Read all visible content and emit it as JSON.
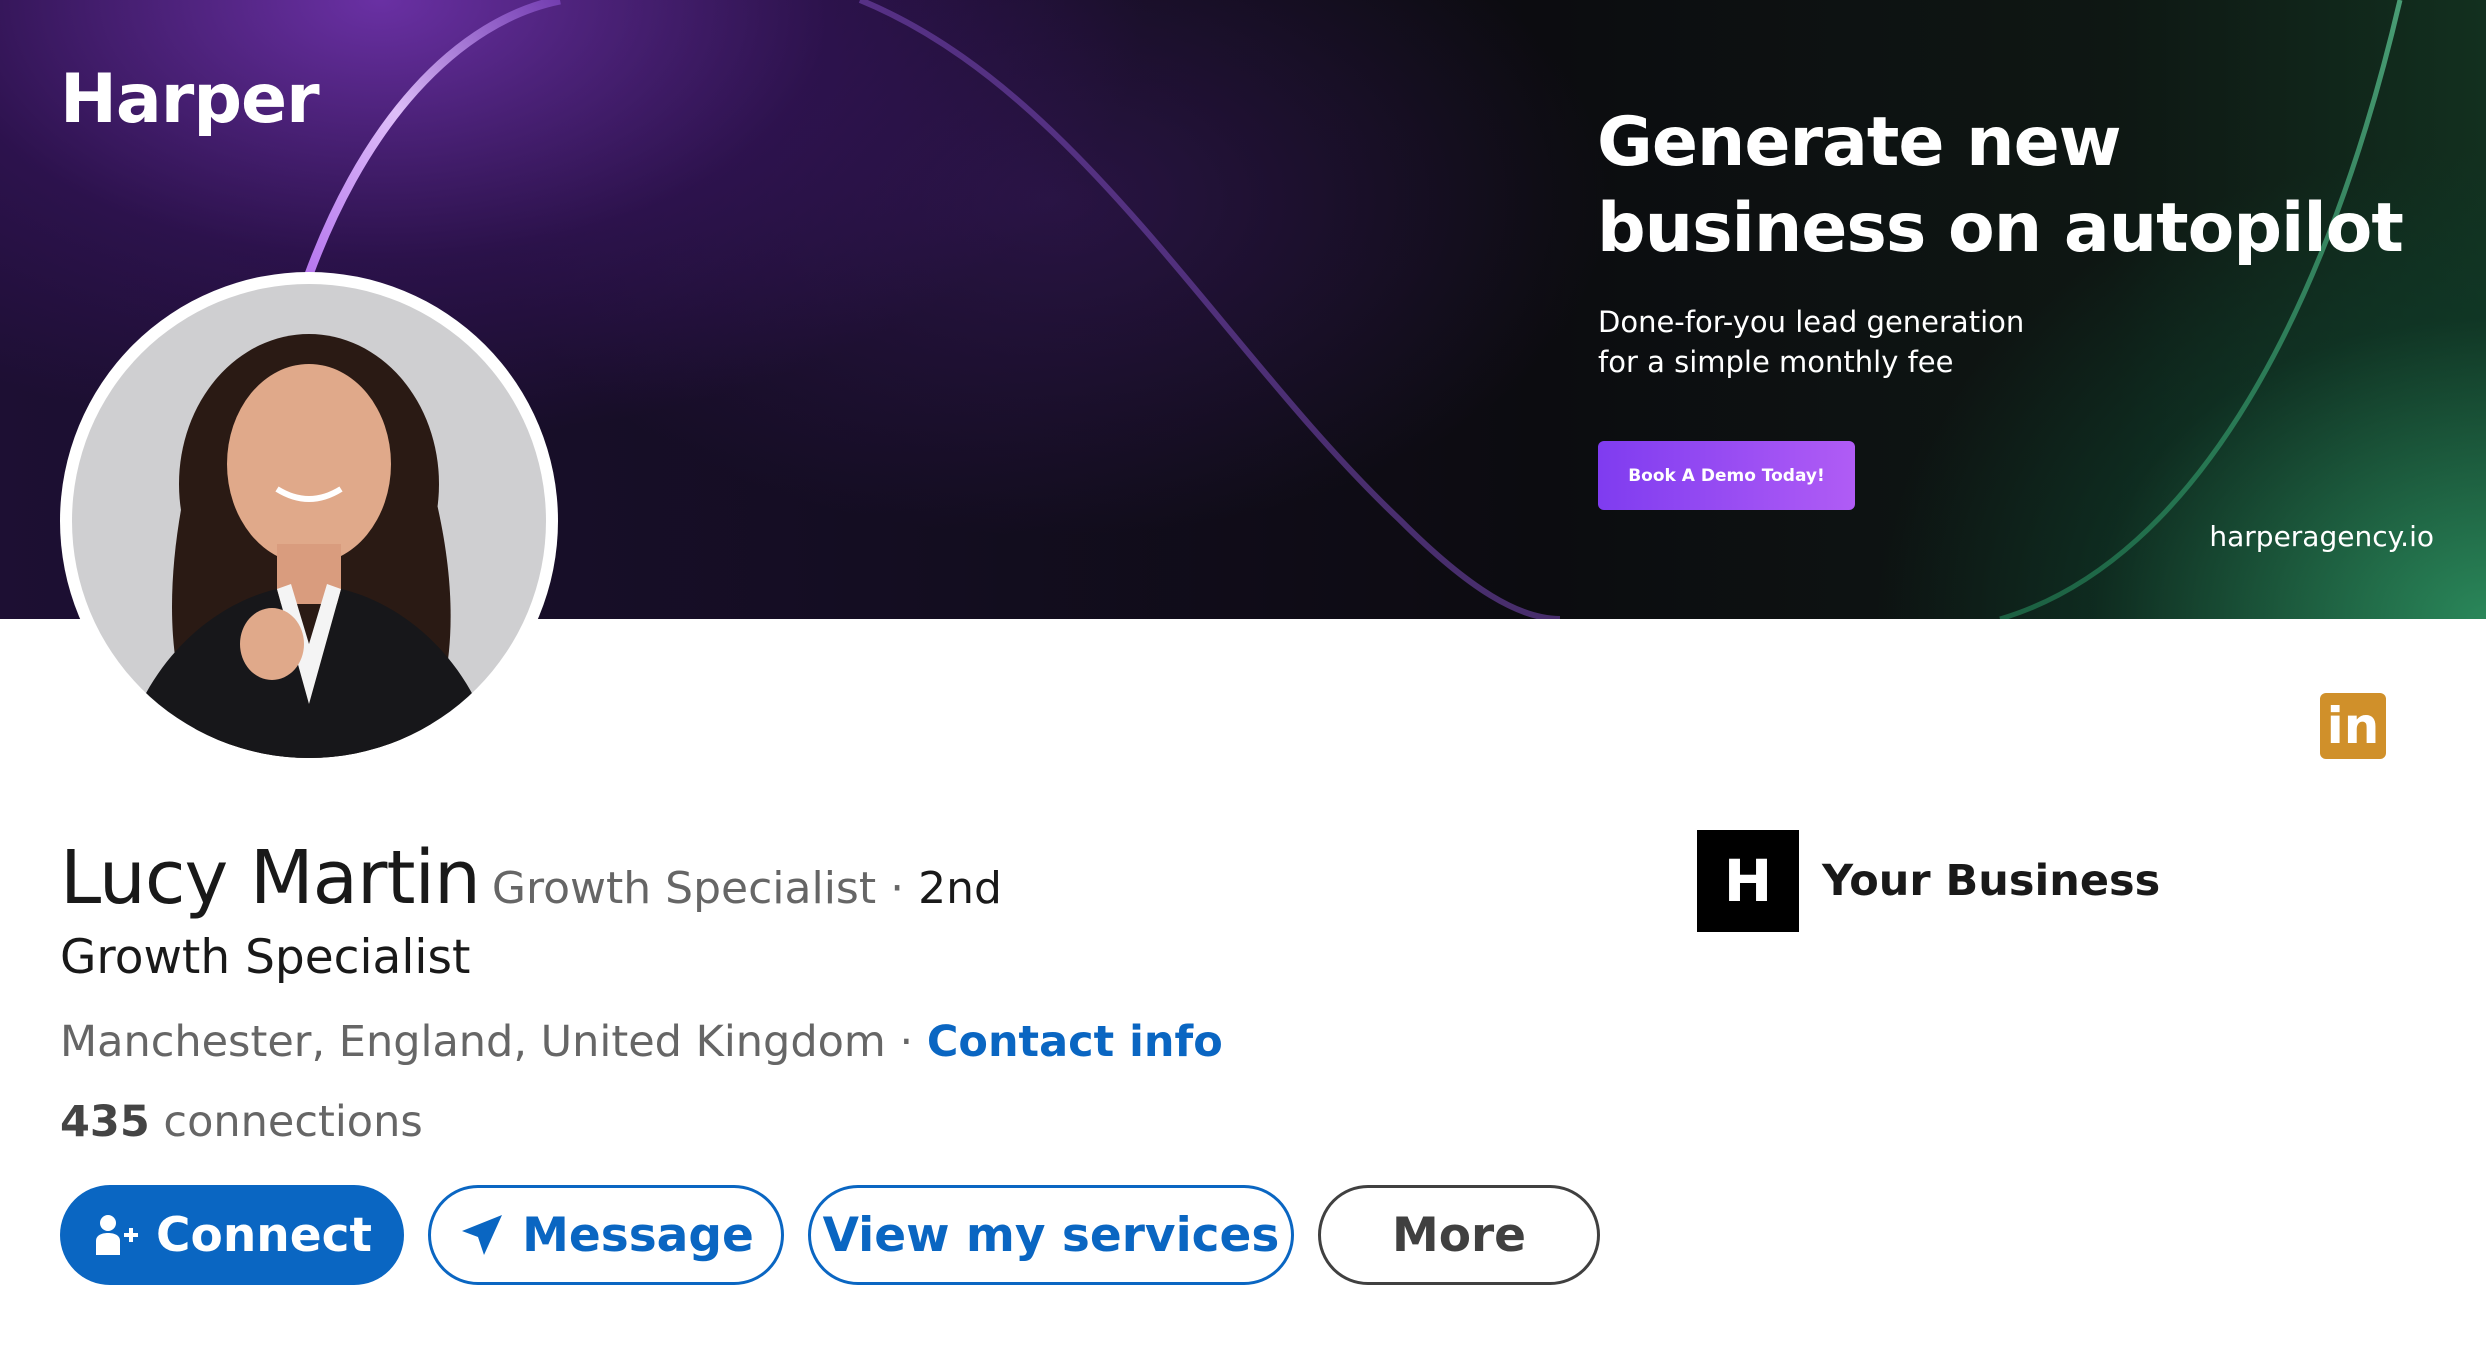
{
  "banner": {
    "brand": "Harper",
    "headline_line1": "Generate new",
    "headline_line2": "business on autopilot",
    "subline_line1": "Done-for-you lead generation",
    "subline_line2": "for a simple monthly fee",
    "cta_label": "Book A Demo Today!",
    "url": "harperagency.io",
    "accent_color": "#9b4cf5"
  },
  "profile": {
    "name": "Lucy Martin",
    "pronoun_title": "Growth Specialist",
    "separator": " · ",
    "degree": "2nd",
    "headline": "Growth Specialist",
    "location": "Manchester, England, United Kingdom",
    "contact_label": "Contact info",
    "connections_count": "435",
    "connections_label": " connections"
  },
  "badge": {
    "icon": "linkedin-icon",
    "text": "in",
    "color": "#d0902a"
  },
  "company": {
    "logo_text": "H",
    "name": "Your Business"
  },
  "actions": {
    "connect": "Connect",
    "message": "Message",
    "services": "View my services",
    "more": "More",
    "primary_color": "#0a66c2"
  }
}
